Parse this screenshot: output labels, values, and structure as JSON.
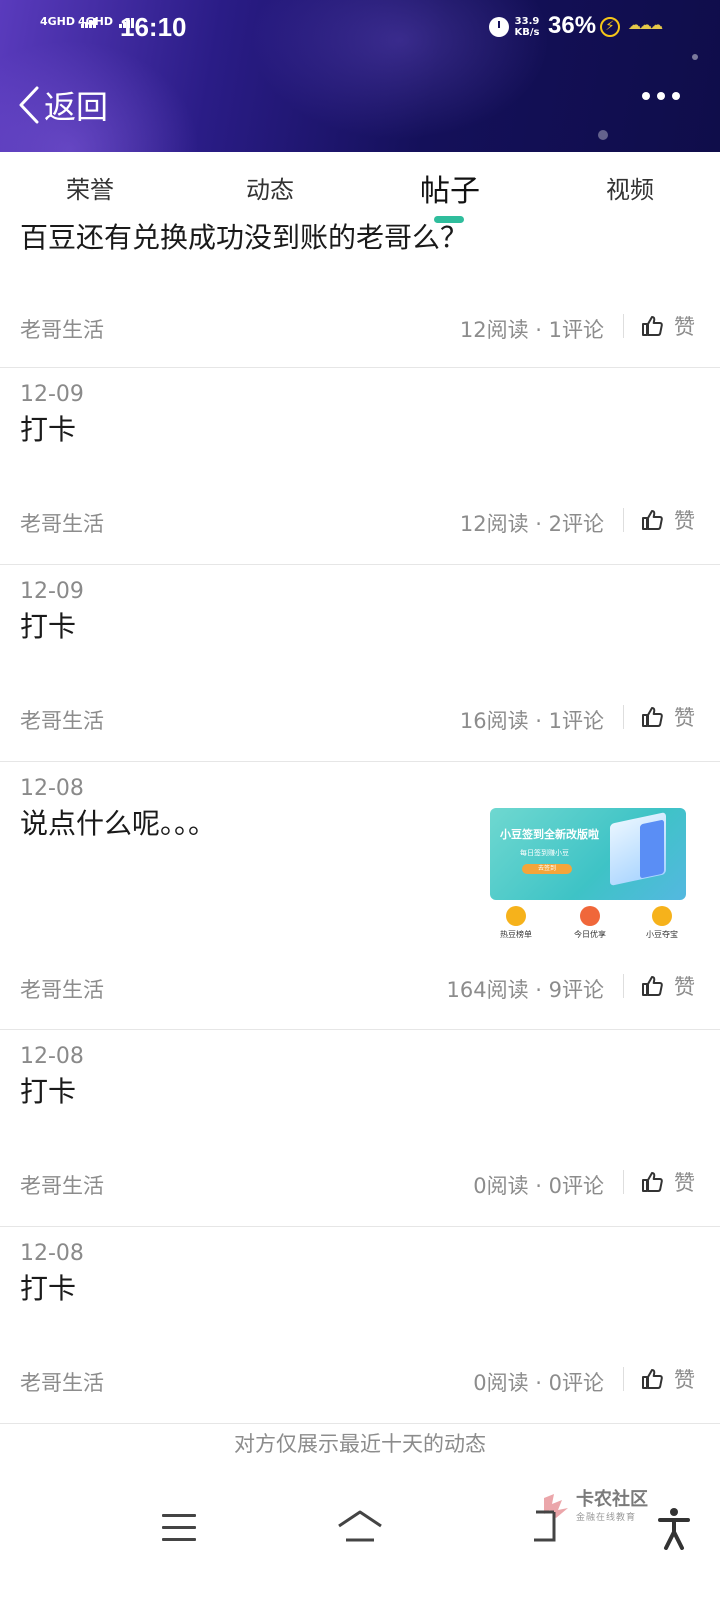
{
  "status_bar": {
    "sim1": "4GHD",
    "sim2": "4GHD",
    "time": "16:10",
    "net_speed_value": "33.9",
    "net_speed_unit": "KB/s",
    "battery": "36%",
    "icons": [
      "alarm-icon",
      "charging-bolt-icon",
      "weather-icon"
    ]
  },
  "header": {
    "back_label": "返回",
    "more_icon": "more-dots-icon"
  },
  "tabs": [
    {
      "label": "荣誉",
      "active": false
    },
    {
      "label": "动态",
      "active": false
    },
    {
      "label": "帖子",
      "active": true
    },
    {
      "label": "视频",
      "active": false
    }
  ],
  "like_label": "赞",
  "posts": [
    {
      "date": "",
      "title": "百豆还有兑换成功没到账的老哥么？",
      "author": "老哥生活",
      "stats": "12阅读 · 1评论",
      "has_image": false
    },
    {
      "date": "12-09",
      "title": "打卡",
      "author": "老哥生活",
      "stats": "12阅读 · 2评论",
      "has_image": false
    },
    {
      "date": "12-09",
      "title": "打卡",
      "author": "老哥生活",
      "stats": "16阅读 · 1评论",
      "has_image": false
    },
    {
      "date": "12-08",
      "title": "说点什么呢。。。",
      "author": "老哥生活",
      "stats": "164阅读 · 9评论",
      "has_image": true
    },
    {
      "date": "12-08",
      "title": "打卡",
      "author": "老哥生活",
      "stats": "0阅读 · 0评论",
      "has_image": false
    },
    {
      "date": "12-08",
      "title": "打卡",
      "author": "老哥生活",
      "stats": "0阅读 · 0评论",
      "has_image": false
    }
  ],
  "thumbnail": {
    "banner_title": "小豆签到全新改版啦",
    "banner_subtitle": "每日签到赚小豆",
    "banner_button": "去签到",
    "icons": [
      {
        "label": "热豆榜单",
        "color": "#f6b21b"
      },
      {
        "label": "今日优享",
        "color": "#f0673a"
      },
      {
        "label": "小豆夺宝",
        "color": "#f6b21b"
      }
    ]
  },
  "footer_note": "对方仅展示最近十天的动态",
  "watermark": {
    "name": "卡农社区",
    "tagline": "金融在线教育"
  },
  "colors": {
    "accent": "#2fbd9c",
    "header_dark": "#14105a",
    "header_purple": "#5a3bbd",
    "muted_text": "#8c8c8c"
  }
}
